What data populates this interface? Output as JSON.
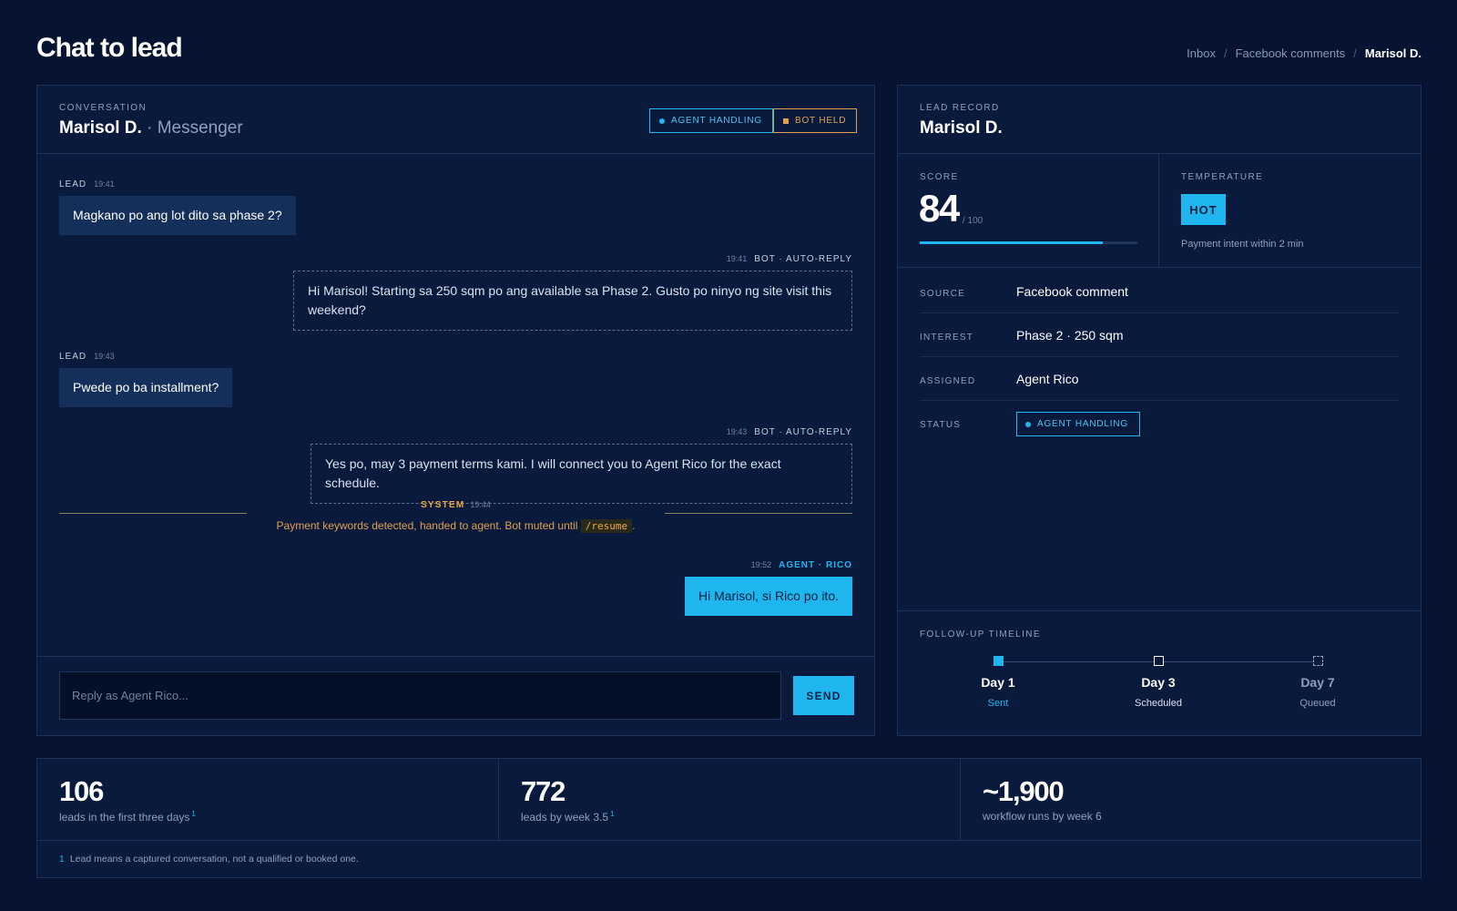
{
  "header": {
    "title": "Chat to lead",
    "breadcrumb": [
      "Inbox",
      "Facebook comments",
      "Marisol D."
    ]
  },
  "conversation": {
    "eyebrow": "CONVERSATION",
    "name": "Marisol D.",
    "channel": "Messenger",
    "badges": {
      "agent": "AGENT HANDLING",
      "bot": "BOT HELD"
    },
    "messages": [
      {
        "sender": "LEAD",
        "time": "19:41",
        "text": "Magkano po ang lot dito sa phase 2?"
      },
      {
        "sender": "BOT · AUTO-REPLY",
        "time": "19:41",
        "text": "Hi Marisol! Starting sa 250 sqm po ang available sa Phase 2. Gusto po ninyo ng site visit this weekend?"
      },
      {
        "sender": "LEAD",
        "time": "19:43",
        "text": "Pwede po ba installment?"
      },
      {
        "sender": "BOT · AUTO-REPLY",
        "time": "19:43",
        "text": "Yes po, may 3 payment terms kami. I will connect you to Agent Rico for the exact schedule."
      },
      {
        "sender": "AGENT · RICO",
        "time": "19:52",
        "text": "Hi Marisol, si Rico po ito."
      }
    ],
    "system": {
      "label": "SYSTEM",
      "time": "19:44",
      "text": "Payment keywords detected, handed to agent. Bot muted until",
      "code": "/resume",
      "end": "."
    },
    "composer": {
      "placeholder": "Reply as Agent Rico...",
      "send": "SEND"
    }
  },
  "lead": {
    "eyebrow": "LEAD RECORD",
    "name": "Marisol D.",
    "score": {
      "label": "SCORE",
      "value": "84",
      "max": "/ 100",
      "fraction": 0.84
    },
    "temperature": {
      "label": "TEMPERATURE",
      "value": "HOT",
      "note": "Payment intent within 2 min"
    },
    "fields": [
      {
        "label": "SOURCE",
        "value": "Facebook comment"
      },
      {
        "label": "INTEREST",
        "value": "Phase 2 · 250 sqm"
      },
      {
        "label": "ASSIGNED",
        "value": "Agent Rico"
      },
      {
        "label": "STATUS",
        "value": "AGENT HANDLING"
      }
    ],
    "timeline": {
      "label": "FOLLOW-UP TIMELINE",
      "steps": [
        {
          "day": "Day 1",
          "status": "Sent"
        },
        {
          "day": "Day 3",
          "status": "Scheduled"
        },
        {
          "day": "Day 7",
          "status": "Queued"
        }
      ]
    }
  },
  "stats": [
    {
      "value": "106",
      "label": "leads in the first three days",
      "note": "1"
    },
    {
      "value": "772",
      "label": "leads by week 3.5",
      "note": "1"
    },
    {
      "value": "~1,900",
      "label": "workflow runs by week 6",
      "note": ""
    }
  ],
  "footnote": {
    "num": "1",
    "text": "Lead means a captured conversation, not a qualified or booked one."
  },
  "colors": {
    "accent": "#1fb6f0",
    "warning": "#e0a050",
    "background": "#061431",
    "panel": "#0a1a3d"
  }
}
